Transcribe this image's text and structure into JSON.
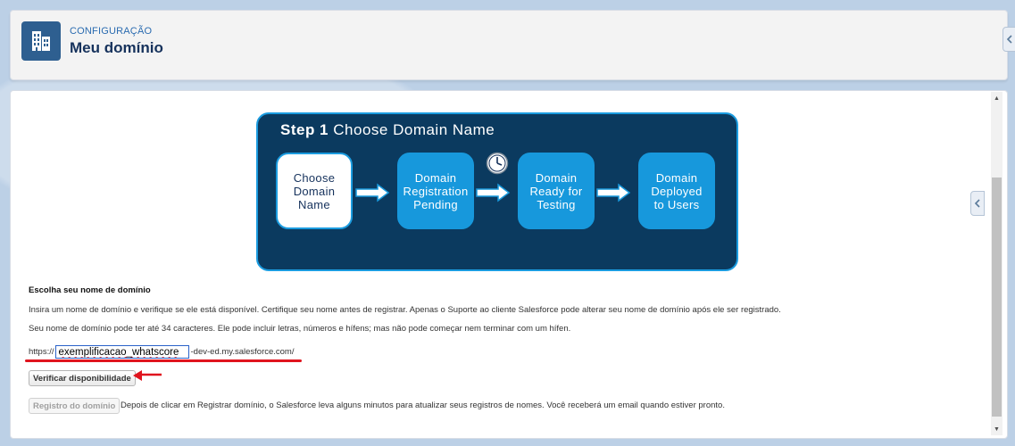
{
  "header": {
    "eyebrow": "CONFIGURAÇÃO",
    "title": "Meu domínio",
    "icon": "building-icon"
  },
  "diagram": {
    "step_label": "Step 1",
    "step_title": "Choose Domain Name",
    "stages": [
      {
        "line1": "Choose",
        "line2": "Domain",
        "line3": "Name"
      },
      {
        "line1": "Domain",
        "line2": "Registration",
        "line3": "Pending"
      },
      {
        "line1": "Domain",
        "line2": "Ready for",
        "line3": "Testing"
      },
      {
        "line1": "Domain",
        "line2": "Deployed",
        "line3": "to Users"
      }
    ]
  },
  "form": {
    "heading": "Escolha seu nome de domínio",
    "instruction": "Insira um nome de domínio e verifique se ele está disponível. Certifique seu nome antes de registrar. Apenas o Suporte ao cliente Salesforce pode alterar seu nome de domínio após ele ser registrado.",
    "rules": "Seu nome de domínio pode ter até 34 caracteres. Ele pode incluir letras, números e hífens; mas não pode começar nem terminar com um hífen.",
    "url_prefix": "https://",
    "domain_value": "exemplificacao_whatscore",
    "url_suffix": "-dev-ed.my.salesforce.com/",
    "check_button": "Verificar disponibilidade",
    "register_button": "Registro do domínio",
    "register_note": "Depois de clicar em Registrar domínio, o Salesforce leva alguns minutos para atualizar seus registros de nomes. Você receberá um email quando estiver pronto."
  },
  "colors": {
    "header_icon_bg": "#2e5f90",
    "diagram_bg": "#0b3a5f",
    "stage_blue": "#1798dc",
    "annotation_red": "#e0141e"
  }
}
